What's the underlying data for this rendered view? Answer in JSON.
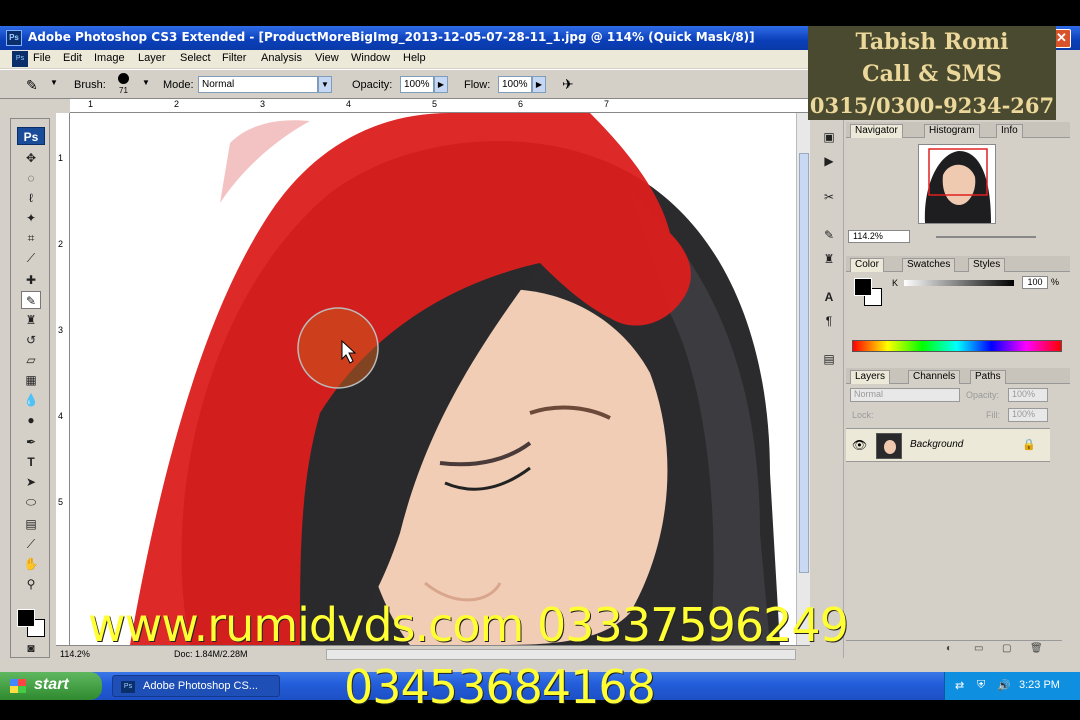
{
  "window": {
    "ps_badge": "Ps",
    "title": "Adobe Photoshop CS3 Extended - [ProductMoreBigImg_2013-12-05-07-28-11_1.jpg @ 114% (Quick Mask/8)]",
    "close": "✕"
  },
  "menu": {
    "badge": "Ps",
    "items": [
      "File",
      "Edit",
      "Image",
      "Layer",
      "Select",
      "Filter",
      "Analysis",
      "View",
      "Window",
      "Help"
    ]
  },
  "options": {
    "brush_label": "Brush:",
    "brush_size": "71",
    "mode_label": "Mode:",
    "mode_value": "Normal",
    "opacity_label": "Opacity:",
    "opacity_value": "100%",
    "flow_label": "Flow:",
    "flow_value": "100%"
  },
  "ruler": {
    "h_ticks": [
      "1",
      "2",
      "3",
      "4",
      "5",
      "6",
      "7"
    ],
    "v_ticks": [
      "1",
      "2",
      "3",
      "4",
      "5"
    ]
  },
  "toolbox": {
    "badge": "Ps"
  },
  "status": {
    "zoom": "114.2%",
    "doc": "Doc: 1.84M/2.28M"
  },
  "navigator": {
    "tabs": [
      "Navigator",
      "Histogram",
      "Info"
    ],
    "zoom": "114.2%"
  },
  "color": {
    "tabs": [
      "Color",
      "Swatches",
      "Styles"
    ],
    "channel": "K",
    "value": "100",
    "unit": "%"
  },
  "layers": {
    "tabs": [
      "Layers",
      "Channels",
      "Paths"
    ],
    "blend": "Normal",
    "opacity_label": "Opacity:",
    "opacity_value": "100%",
    "lock_label": "Lock:",
    "fill_label": "Fill:",
    "fill_value": "100%",
    "layer_name": "Background"
  },
  "watermark": {
    "line1": "Tabish Romi",
    "line2": "Call & SMS",
    "line3": "0315/0300-9234-267"
  },
  "overlay": {
    "url_phone": "www.rumidvds.com  03337596249",
    "phone2": "03453684168"
  },
  "taskbar": {
    "start": "start",
    "app_item": "Adobe Photoshop CS...",
    "clock": "3:23 PM"
  },
  "colors": {
    "mask_red": "#dc1e1e",
    "xp_blue": "#245edb",
    "overlay_yellow": "#ffff33"
  },
  "icons": [
    "brush-icon",
    "move-icon",
    "marquee-icon",
    "lasso-icon",
    "magic-wand-icon",
    "crop-icon",
    "eyedropper-icon",
    "heal-icon",
    "brush-tool-icon",
    "stamp-icon",
    "history-brush-icon",
    "eraser-icon",
    "gradient-icon",
    "blur-icon",
    "dodge-icon",
    "pen-icon",
    "type-icon",
    "path-select-icon",
    "shape-icon",
    "notes-icon",
    "hand-icon",
    "zoom-icon",
    "eye-icon",
    "lock-icon"
  ]
}
